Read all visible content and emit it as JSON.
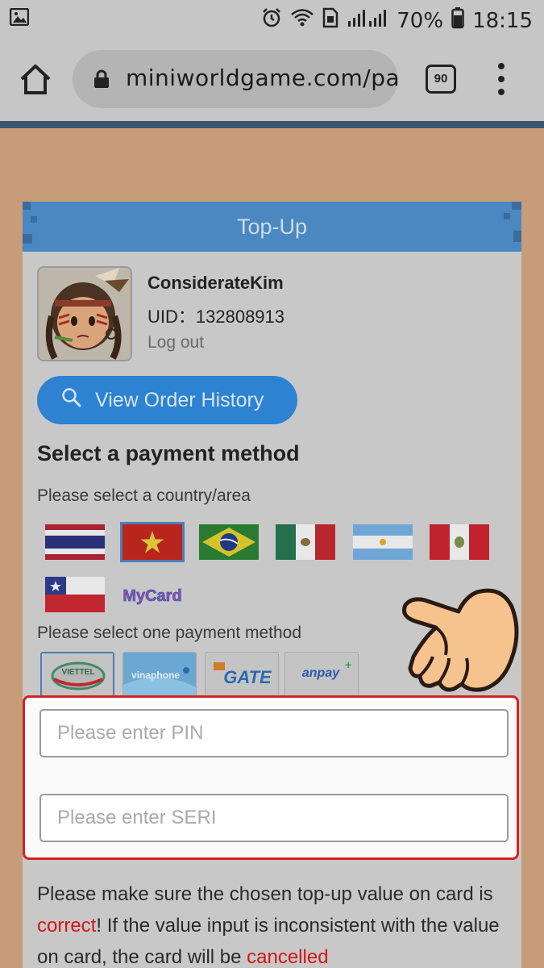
{
  "status_bar": {
    "battery": "70%",
    "time": "18:15"
  },
  "browser": {
    "url": "miniworldgame.com/paym",
    "tab_count": "90"
  },
  "card": {
    "title": "Top-Up",
    "user": {
      "name": "ConsiderateKim",
      "uid_label": "UID：132808913",
      "logout_label": "Log out"
    },
    "history_button": "View Order History",
    "section_title": "Select a payment method",
    "country_prompt": "Please select a country/area",
    "flags": [
      "thailand-flag",
      "vietnam-flag",
      "brazil-flag",
      "mexico-flag",
      "argentina-flag",
      "peru-flag",
      "chile-flag",
      "mycard"
    ],
    "selected_flag": "vietnam-flag",
    "flag_mycard_text": "MyCard",
    "method_prompt": "Please select one payment method",
    "methods": {
      "viettel": "VIETTEL",
      "vinaphone": "vinaphone",
      "gate": "GATE",
      "anpay": "anpay+"
    },
    "selected_method": "viettel",
    "pin_placeholder": "Please enter PIN",
    "seri_placeholder": "Please enter SERI",
    "notice": {
      "part1": "Please make sure the chosen top-up value on card is ",
      "correct": "correct",
      "part2": "! If the value input is inconsistent with the value on card, the card will be ",
      "cancelled": "cancelled"
    }
  },
  "colors": {
    "page_bg": "#c79d79",
    "header_blue": "#4b87c1",
    "button_blue": "#2d82d2",
    "highlight_red": "#d32222"
  }
}
